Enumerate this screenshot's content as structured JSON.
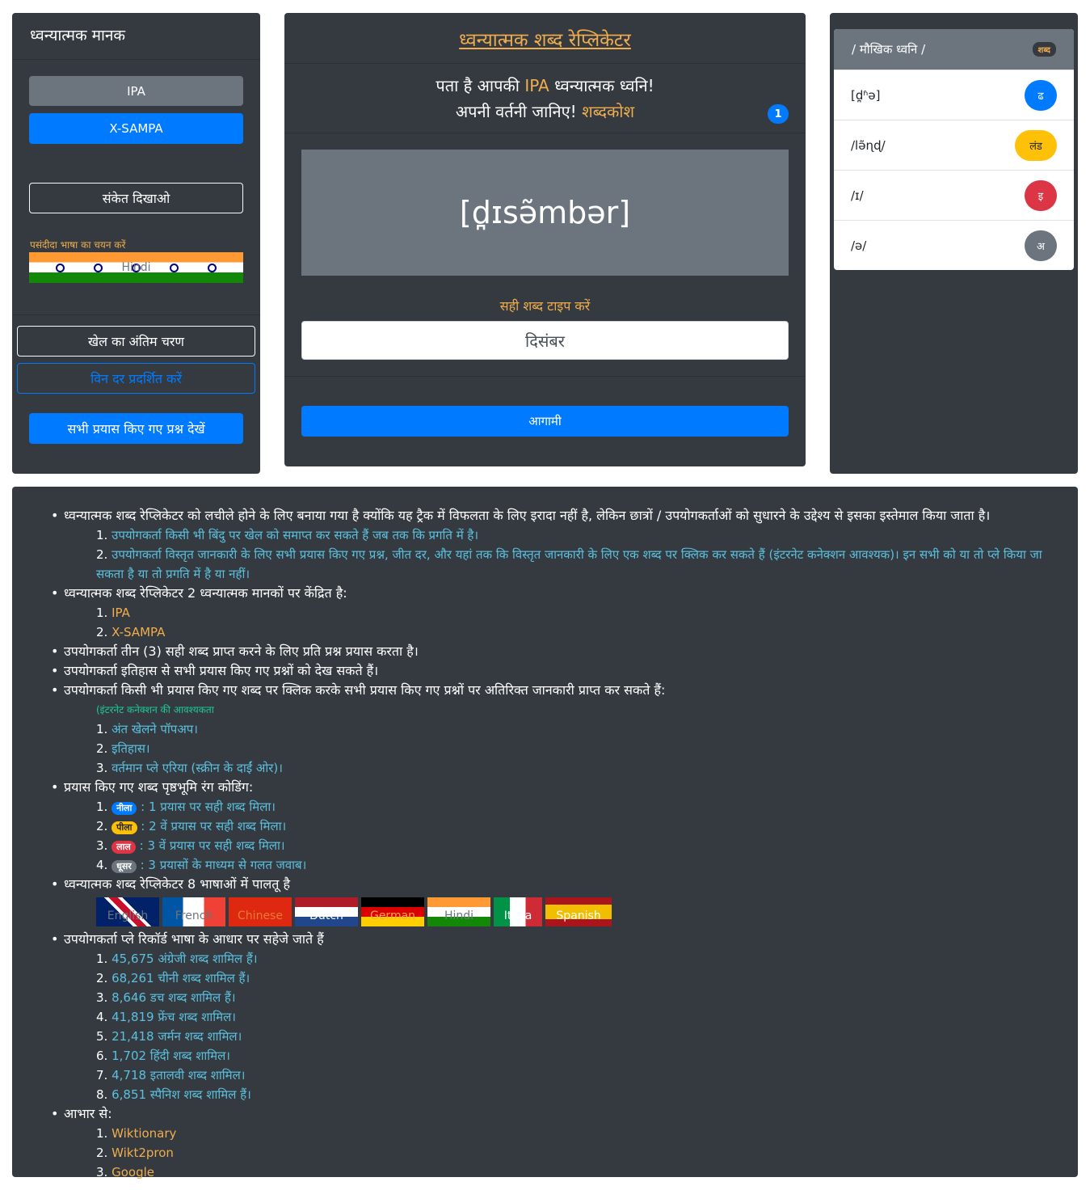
{
  "left": {
    "title": "ध्वन्यात्मक मानक",
    "btn_ipa": "IPA",
    "btn_xsampa": "X-SAMPA",
    "btn_hint": "संकेत दिखाओ",
    "lang_label": "पसंदीदा भाषा का चयन करें",
    "lang_flag_text": "Hindi",
    "btn_end": "खेल का अंतिम चरण",
    "btn_winrate": "विन दर प्रदर्शित करें",
    "btn_all": "सभी प्रयास किए गए प्रश्न देखें"
  },
  "center": {
    "title": "ध्वन्यात्मक शब्द रेप्लिकेटर",
    "line1_a": "पता है आपकी ",
    "line1_b": "IPA",
    "line1_c": " ध्वन्यात्मक ध्वनि!",
    "line2_a": "अपनी वर्तनी जानिए! ",
    "line2_b": "शब्दकोश",
    "badge": "1",
    "phonetic": "[d̪ɪsə̃mbər]",
    "type_label": "सही शब्द टाइप करें",
    "input_value": "दिसंबर",
    "btn_next": "आगामी"
  },
  "right": {
    "head": "/ मौखिक ध्वनि /",
    "head_badge": "शब्द",
    "items": [
      {
        "sound": "[d̪ʱə]",
        "letter": "ढ"
      },
      {
        "sound": "/lə̃ɳɖ/",
        "letter": "लंड"
      },
      {
        "sound": "/ɪ/",
        "letter": "इ"
      },
      {
        "sound": "/ə/",
        "letter": "अ"
      }
    ]
  },
  "info": {
    "b1": "ध्वन्यात्मक शब्द रेप्लिकेटर को लचीले होने के लिए बनाया गया है क्योंकि यह ट्रैक में विफलता के लिए इरादा नहीं है, लेकिन छात्रों / उपयोगकर्ताओं को सुधारने के उद्देश्य से इसका इस्तेमाल किया जाता है।",
    "b1_1": "उपयोगकर्ता किसी भी बिंदु पर खेल को समाप्त कर सकते हैं जब तक कि प्रगति में है।",
    "b1_2": "उपयोगकर्ता विस्तृत जानकारी के लिए सभी प्रयास किए गए प्रश्न, जीत दर, और यहां तक कि विस्तृत जानकारी के लिए एक शब्द पर क्लिक कर सकते हैं (इंटरनेट कनेक्शन आवश्यक)। इन सभी को या तो प्ले किया जा सकता है या तो प्रगति में है या नहीं।",
    "b2": "ध्वन्यात्मक शब्द रेप्लिकेटर 2 ध्वन्यात्मक मानकों पर केंद्रित है:",
    "b2_1": "IPA",
    "b2_2": "X-SAMPA",
    "b3": "उपयोगकर्ता तीन (3) सही शब्द प्राप्त करने के लिए प्रति प्रश्न प्रयास करता है।",
    "b4": "उपयोगकर्ता इतिहास से सभी प्रयास किए गए प्रश्नों को देख सकते हैं।",
    "b5": "उपयोगकर्ता किसी भी प्रयास किए गए शब्द पर क्लिक करके सभी प्रयास किए गए प्रश्नों पर अतिरिक्त जानकारी प्राप्त कर सकते हैं:",
    "b5_note": "(इंटरनेट कनेक्शन की आवश्यकता",
    "b5_1": "अंत खेलने पॉपअप।",
    "b5_2": "इतिहास।",
    "b5_3": "वर्तमान प्ले एरिया (स्क्रीन के दाईं ओर)।",
    "b6": "प्रयास किए गए शब्द पृष्ठभूमि रंग कोडिंग:",
    "b6_1_badge": "नीला",
    "b6_1": " : 1 प्रयास पर सही शब्द मिला।",
    "b6_2_badge": "पीला",
    "b6_2": " : 2 वें प्रयास पर सही शब्द मिला।",
    "b6_3_badge": "लाल",
    "b6_3": " : 3 वें प्रयास पर सही शब्द मिला।",
    "b6_4_badge": "धूसर",
    "b6_4": " : 3 प्रयासों के माध्यम से गलत जवाब।",
    "b7": "ध्वन्यात्मक शब्द रेप्लिकेटर 8 भाषाओं में पालतू है",
    "flags": [
      "English",
      "French",
      "Chinese",
      "Dutch",
      "German",
      "Hindi",
      "Italia",
      "Spanish"
    ],
    "b8": "उपयोगकर्ता प्ले रिकॉर्ड भाषा के आधार पर सहेजे जाते हैं",
    "b8_1": "45,675 अंग्रेजी शब्द शामिल हैं।",
    "b8_2": "68,261 चीनी शब्द शामिल हैं।",
    "b8_3": "8,646 डच शब्द शामिल हैं।",
    "b8_4": "41,819 फ्रेंच शब्द शामिल।",
    "b8_5": "21,418 जर्मन शब्द शामिल।",
    "b8_6": "1,702 हिंदी शब्द शामिल।",
    "b8_7": "4,718 इतालवी शब्द शामिल।",
    "b8_8": "6,851 स्पैनिश शब्द शामिल हैं।",
    "b9": "आभार से:",
    "b9_1": "Wiktionary",
    "b9_2": "Wikt2pron",
    "b9_3": "Google"
  }
}
